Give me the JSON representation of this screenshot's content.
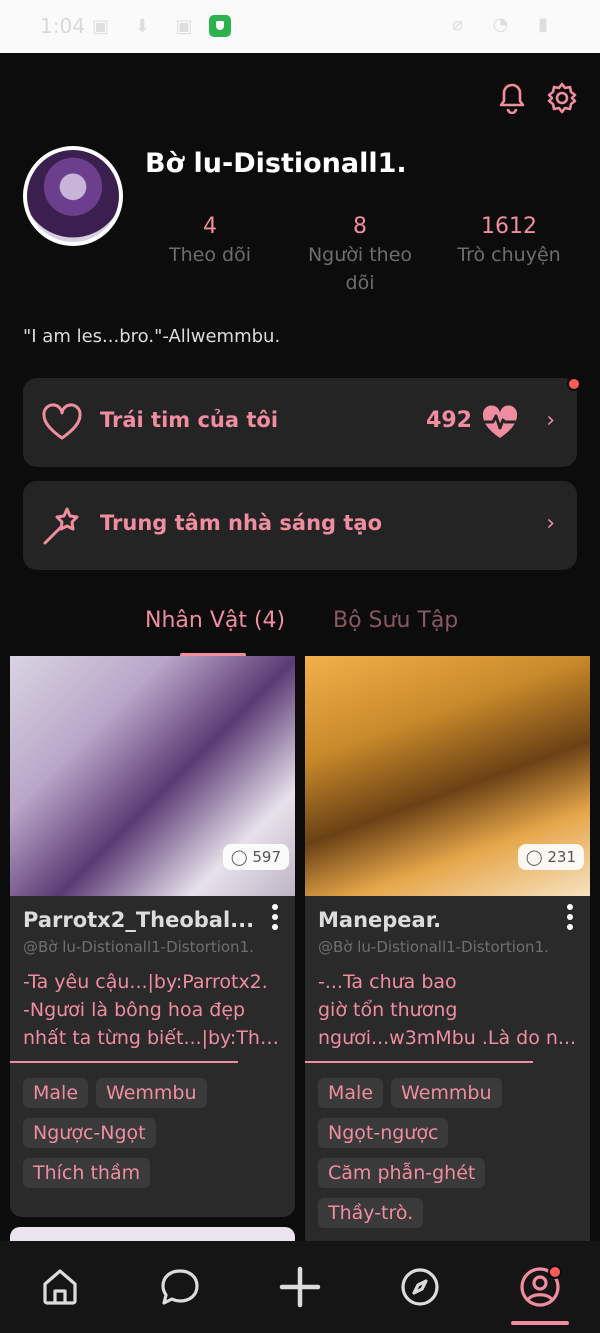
{
  "status_bar": {
    "time": "1:04",
    "icons_left": "▣ ⬇ ▣ ✕",
    "icons_right": "⌀ ◔ ▮"
  },
  "header": {
    "username": "Bờ lu-Distionall1.",
    "stats": [
      {
        "value": "4",
        "label": "Theo dõi"
      },
      {
        "value": "8",
        "label": "Người theo dõi"
      },
      {
        "value": "1612",
        "label": "Trò chuyện"
      }
    ],
    "bio": "\"I am les...bro.\"-Allwemmbu."
  },
  "hearts_card": {
    "label": "Trái tim của tôi",
    "count": "492"
  },
  "creator_card": {
    "label": "Trung tâm nhà sáng tạo"
  },
  "tabs": {
    "characters": "Nhân Vật (4)",
    "collection": "Bộ Sưu Tập"
  },
  "characters": [
    {
      "name": "Parrotx2_Theobal...",
      "handle": "@Bờ lu-Distionall1-Distortion1.",
      "chat_count": "597",
      "desc_lines": [
        "-Ta yêu cậu...|by:Parrotx2.",
        "-Ngươi là bông hoa đẹp",
        "nhất ta từng biết...|by:The..."
      ],
      "tags": [
        "Male",
        "Wemmbu",
        "Ngược-Ngọt",
        "Thích thầm"
      ]
    },
    {
      "name": "Manepear.",
      "handle": "@Bờ lu-Distionall1-Distortion1.",
      "chat_count": "231",
      "desc_lines": [
        "-...Ta chưa bao",
        "giờ tổn thương",
        "ngươi...w3mMbu .Là do n..."
      ],
      "tags": [
        "Male",
        "Wemmbu",
        "Ngọt-ngược",
        "Căm phẫn-ghét",
        "Thầy-trò."
      ]
    }
  ],
  "colors": {
    "accent": "#f08da0",
    "background": "#0c0c0c",
    "card": "#242424"
  },
  "nav_icons": [
    "home-icon",
    "chat-icon",
    "add-icon",
    "explore-icon",
    "profile-icon"
  ]
}
